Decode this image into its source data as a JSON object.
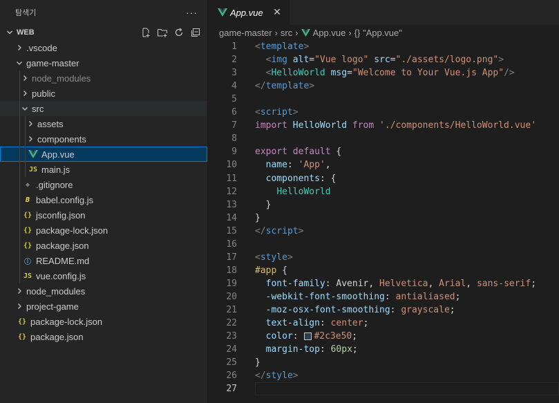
{
  "sidebar": {
    "title": "탐색기",
    "more": "···",
    "workspace": "WEB",
    "items": [
      {
        "label": ".vscode",
        "depth": 1,
        "chev": "right",
        "icon": "",
        "icon_name": "folder"
      },
      {
        "label": "game-master",
        "depth": 1,
        "chev": "down",
        "icon": "",
        "icon_name": "folder"
      },
      {
        "label": "node_modules",
        "depth": 2,
        "chev": "right",
        "icon": "",
        "icon_name": "folder",
        "dim": true
      },
      {
        "label": "public",
        "depth": 2,
        "chev": "right",
        "icon": "",
        "icon_name": "folder"
      },
      {
        "label": "src",
        "depth": 2,
        "chev": "down",
        "icon": "",
        "icon_name": "folder",
        "openbg": true
      },
      {
        "label": "assets",
        "depth": 3,
        "chev": "right",
        "icon": "",
        "icon_name": "folder"
      },
      {
        "label": "components",
        "depth": 3,
        "chev": "right",
        "icon": "",
        "icon_name": "folder"
      },
      {
        "label": "App.vue",
        "depth": 3,
        "chev": "",
        "icon": "vue",
        "icon_name": "vue-icon",
        "selected": true
      },
      {
        "label": "main.js",
        "depth": 3,
        "chev": "",
        "icon": "JS",
        "icon_name": "js-file-icon"
      },
      {
        "label": ".gitignore",
        "depth": 2,
        "chev": "",
        "icon": "◆",
        "icon_name": "git-file-icon"
      },
      {
        "label": "babel.config.js",
        "depth": 2,
        "chev": "",
        "icon": "B",
        "icon_name": "babel-file-icon"
      },
      {
        "label": "jsconfig.json",
        "depth": 2,
        "chev": "",
        "icon": "{}",
        "icon_name": "json-file-icon"
      },
      {
        "label": "package-lock.json",
        "depth": 2,
        "chev": "",
        "icon": "{}",
        "icon_name": "json-file-icon"
      },
      {
        "label": "package.json",
        "depth": 2,
        "chev": "",
        "icon": "{}",
        "icon_name": "json-file-icon"
      },
      {
        "label": "README.md",
        "depth": 2,
        "chev": "",
        "icon": "ⓘ",
        "icon_name": "info-file-icon"
      },
      {
        "label": "vue.config.js",
        "depth": 2,
        "chev": "",
        "icon": "JS",
        "icon_name": "js-file-icon"
      },
      {
        "label": "node_modules",
        "depth": 1,
        "chev": "right",
        "icon": "",
        "icon_name": "folder"
      },
      {
        "label": "project-game",
        "depth": 1,
        "chev": "right",
        "icon": "",
        "icon_name": "folder"
      },
      {
        "label": "package-lock.json",
        "depth": 1,
        "chev": "",
        "icon": "{}",
        "icon_name": "json-file-icon"
      },
      {
        "label": "package.json",
        "depth": 1,
        "chev": "",
        "icon": "{}",
        "icon_name": "json-file-icon"
      }
    ]
  },
  "editor": {
    "tab": {
      "name": "App.vue",
      "close": "✕"
    },
    "breadcrumb": [
      "game-master",
      "src",
      "App.vue",
      "{} \"App.vue\""
    ],
    "lines": [
      [
        [
          "c-punc",
          "<"
        ],
        [
          "c-tag",
          "template"
        ],
        [
          "c-punc",
          ">"
        ]
      ],
      [
        [
          "c-txt",
          "  "
        ],
        [
          "c-punc",
          "<"
        ],
        [
          "c-tag",
          "img"
        ],
        [
          "c-txt",
          " "
        ],
        [
          "c-attr",
          "alt"
        ],
        [
          "c-txt",
          "="
        ],
        [
          "c-str",
          "\"Vue logo\""
        ],
        [
          "c-txt",
          " "
        ],
        [
          "c-attr",
          "src"
        ],
        [
          "c-txt",
          "="
        ],
        [
          "c-str",
          "\"./assets/logo.png\""
        ],
        [
          "c-punc",
          ">"
        ]
      ],
      [
        [
          "c-txt",
          "  "
        ],
        [
          "c-punc",
          "<"
        ],
        [
          "c-comp",
          "HelloWorld"
        ],
        [
          "c-txt",
          " "
        ],
        [
          "c-attr",
          "msg"
        ],
        [
          "c-txt",
          "="
        ],
        [
          "c-str",
          "\"Welcome to Your Vue.js App\""
        ],
        [
          "c-punc",
          "/>"
        ]
      ],
      [
        [
          "c-punc",
          "</"
        ],
        [
          "c-tag",
          "template"
        ],
        [
          "c-punc",
          ">"
        ]
      ],
      [],
      [
        [
          "c-punc",
          "<"
        ],
        [
          "c-tag",
          "script"
        ],
        [
          "c-punc",
          ">"
        ]
      ],
      [
        [
          "c-kw",
          "import"
        ],
        [
          "c-txt",
          " "
        ],
        [
          "c-var",
          "HelloWorld"
        ],
        [
          "c-txt",
          " "
        ],
        [
          "c-kw",
          "from"
        ],
        [
          "c-txt",
          " "
        ],
        [
          "c-str",
          "'./components/HelloWorld.vue'"
        ]
      ],
      [],
      [
        [
          "c-kw",
          "export"
        ],
        [
          "c-txt",
          " "
        ],
        [
          "c-kw",
          "default"
        ],
        [
          "c-txt",
          " {"
        ]
      ],
      [
        [
          "c-txt",
          "  "
        ],
        [
          "c-prop",
          "name"
        ],
        [
          "c-txt",
          ": "
        ],
        [
          "c-str",
          "'App'"
        ],
        [
          "c-txt",
          ","
        ]
      ],
      [
        [
          "c-txt",
          "  "
        ],
        [
          "c-prop",
          "components"
        ],
        [
          "c-txt",
          ": {"
        ]
      ],
      [
        [
          "c-txt",
          "    "
        ],
        [
          "c-comp",
          "HelloWorld"
        ]
      ],
      [
        [
          "c-txt",
          "  }"
        ]
      ],
      [
        [
          "c-txt",
          "}"
        ]
      ],
      [
        [
          "c-punc",
          "</"
        ],
        [
          "c-tag",
          "script"
        ],
        [
          "c-punc",
          ">"
        ]
      ],
      [],
      [
        [
          "c-punc",
          "<"
        ],
        [
          "c-tag",
          "style"
        ],
        [
          "c-punc",
          ">"
        ]
      ],
      [
        [
          "c-sel",
          "#app"
        ],
        [
          "c-txt",
          " {"
        ]
      ],
      [
        [
          "c-txt",
          "  "
        ],
        [
          "c-prop",
          "font-family"
        ],
        [
          "c-txt",
          ": Avenir, "
        ],
        [
          "c-str",
          "Helvetica"
        ],
        [
          "c-txt",
          ", "
        ],
        [
          "c-str",
          "Arial"
        ],
        [
          "c-txt",
          ", "
        ],
        [
          "c-str",
          "sans-serif"
        ],
        [
          "c-txt",
          ";"
        ]
      ],
      [
        [
          "c-txt",
          "  "
        ],
        [
          "c-prop",
          "-webkit-font-smoothing"
        ],
        [
          "c-txt",
          ": "
        ],
        [
          "c-str",
          "antialiased"
        ],
        [
          "c-txt",
          ";"
        ]
      ],
      [
        [
          "c-txt",
          "  "
        ],
        [
          "c-prop",
          "-moz-osx-font-smoothing"
        ],
        [
          "c-txt",
          ": "
        ],
        [
          "c-str",
          "grayscale"
        ],
        [
          "c-txt",
          ";"
        ]
      ],
      [
        [
          "c-txt",
          "  "
        ],
        [
          "c-prop",
          "text-align"
        ],
        [
          "c-txt",
          ": "
        ],
        [
          "c-str",
          "center"
        ],
        [
          "c-txt",
          ";"
        ]
      ],
      [
        [
          "c-txt",
          "  "
        ],
        [
          "c-prop",
          "color"
        ],
        [
          "c-txt",
          ": "
        ],
        [
          "swatch",
          ""
        ],
        [
          "c-str",
          "#2c3e50"
        ],
        [
          "c-txt",
          ";"
        ]
      ],
      [
        [
          "c-txt",
          "  "
        ],
        [
          "c-prop",
          "margin-top"
        ],
        [
          "c-txt",
          ": "
        ],
        [
          "c-num",
          "60px"
        ],
        [
          "c-txt",
          ";"
        ]
      ],
      [
        [
          "c-txt",
          "}"
        ]
      ],
      [
        [
          "c-punc",
          "</"
        ],
        [
          "c-tag",
          "style"
        ],
        [
          "c-punc",
          ">"
        ]
      ],
      []
    ],
    "current_line": 27,
    "swatch_color": "#2c3e50"
  }
}
